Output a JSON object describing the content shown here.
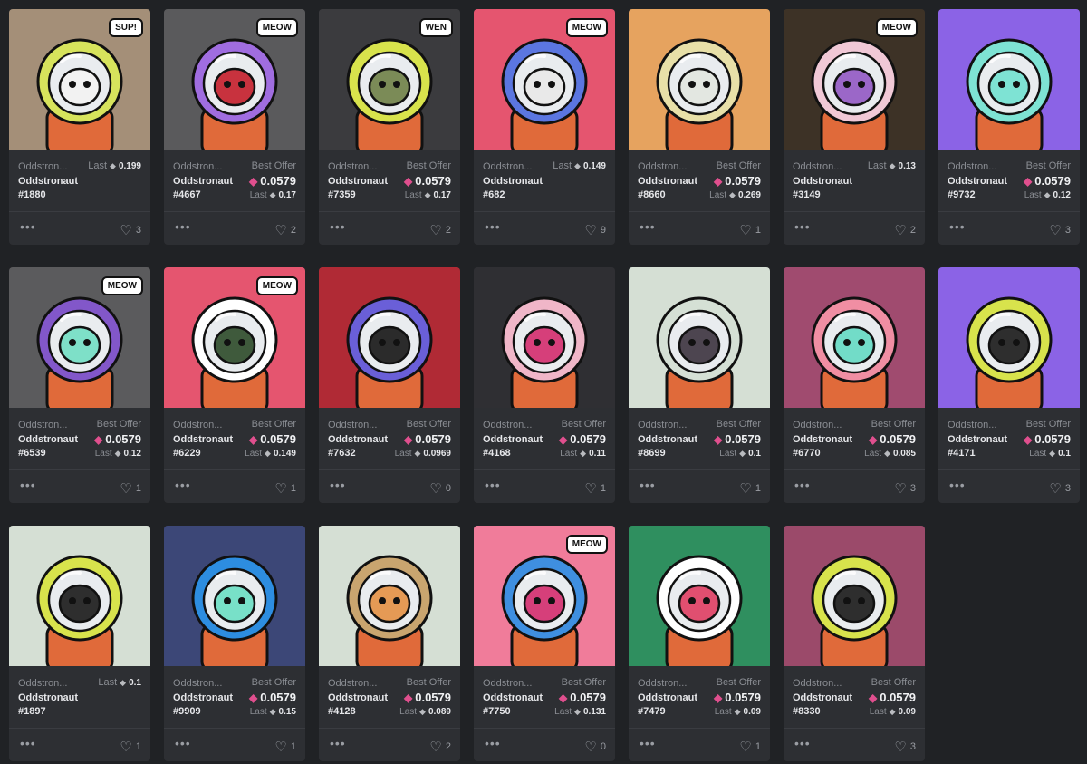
{
  "labels": {
    "best_offer": "Best Offer",
    "last": "Last"
  },
  "icons": {
    "more": "more-options-icon",
    "heart": "heart-icon",
    "eth": "ethereum-icon"
  },
  "colors": {
    "background": "#202225",
    "card": "#2d2f33",
    "accent_eth": "#e04f8e"
  },
  "cards": [
    {
      "collection": "Oddstron...",
      "name": "Oddstronaut",
      "number": "#1880",
      "has_offer": false,
      "offer": "",
      "last": "0.199",
      "likes": "3",
      "bg": "#a48f78",
      "speech": "SUP!",
      "helmet": "#d7e35c",
      "face": "#f2f2f2"
    },
    {
      "collection": "Oddstron...",
      "name": "Oddstronaut",
      "number": "#4667",
      "has_offer": true,
      "offer": "0.0579",
      "last": "0.17",
      "likes": "2",
      "bg": "#5a5a5c",
      "speech": "MEOW",
      "helmet": "#a06de0",
      "face": "#c8323e"
    },
    {
      "collection": "Oddstron...",
      "name": "Oddstronaut",
      "number": "#7359",
      "has_offer": true,
      "offer": "0.0579",
      "last": "0.17",
      "likes": "2",
      "bg": "#3b3b3e",
      "speech": "WEN",
      "helmet": "#d8e34c",
      "face": "#7b8b57"
    },
    {
      "collection": "Oddstron...",
      "name": "Oddstronaut",
      "number": "#682",
      "has_offer": false,
      "offer": "",
      "last": "0.149",
      "likes": "9",
      "bg": "#e5556f",
      "speech": "MEOW",
      "helmet": "#5b76e0",
      "face": "#e9e9e9"
    },
    {
      "collection": "Oddstron...",
      "name": "Oddstronaut",
      "number": "#8660",
      "has_offer": true,
      "offer": "0.0579",
      "last": "0.269",
      "likes": "1",
      "bg": "#e6a35f",
      "speech": "",
      "helmet": "#e8e0a8",
      "face": "#e3e7e1"
    },
    {
      "collection": "Oddstron...",
      "name": "Oddstronaut",
      "number": "#3149",
      "has_offer": false,
      "offer": "",
      "last": "0.13",
      "likes": "2",
      "bg": "#3d3226",
      "speech": "MEOW",
      "helmet": "#f0c8d6",
      "face": "#9b67c8"
    },
    {
      "collection": "Oddstron...",
      "name": "Oddstronaut",
      "number": "#9732",
      "has_offer": true,
      "offer": "0.0579",
      "last": "0.12",
      "likes": "3",
      "bg": "#8b63e6",
      "speech": "",
      "helmet": "#7ee3d4",
      "face": "#7ee3d4"
    },
    {
      "collection": "Oddstron...",
      "name": "Oddstronaut",
      "number": "#6539",
      "has_offer": true,
      "offer": "0.0579",
      "last": "0.12",
      "likes": "1",
      "bg": "#5b5b5d",
      "speech": "MEOW",
      "helmet": "#8257c9",
      "face": "#7ee0c8"
    },
    {
      "collection": "Oddstron...",
      "name": "Oddstronaut",
      "number": "#6229",
      "has_offer": true,
      "offer": "0.0579",
      "last": "0.149",
      "likes": "1",
      "bg": "#e5556f",
      "speech": "MEOW",
      "helmet": "#ffffff",
      "face": "#3f5a3c"
    },
    {
      "collection": "Oddstron...",
      "name": "Oddstronaut",
      "number": "#7632",
      "has_offer": true,
      "offer": "0.0579",
      "last": "0.0969",
      "likes": "0",
      "bg": "#b02a35",
      "speech": "",
      "helmet": "#6a5fd8",
      "face": "#2b2b2b"
    },
    {
      "collection": "Oddstron...",
      "name": "Oddstronaut",
      "number": "#4168",
      "has_offer": true,
      "offer": "0.0579",
      "last": "0.11",
      "likes": "1",
      "bg": "#2f2f33",
      "speech": "",
      "helmet": "#f0b6c8",
      "face": "#d63f7a"
    },
    {
      "collection": "Oddstron...",
      "name": "Oddstronaut",
      "number": "#8699",
      "has_offer": true,
      "offer": "0.0579",
      "last": "0.1",
      "likes": "1",
      "bg": "#d5dfd4",
      "speech": "",
      "helmet": "#d5e0d5",
      "face": "#4d4550"
    },
    {
      "collection": "Oddstron...",
      "name": "Oddstronaut",
      "number": "#6770",
      "has_offer": true,
      "offer": "0.0579",
      "last": "0.085",
      "likes": "3",
      "bg": "#a04b6f",
      "speech": "",
      "helmet": "#f08ea3",
      "face": "#72dcc8"
    },
    {
      "collection": "Oddstron...",
      "name": "Oddstronaut",
      "number": "#4171",
      "has_offer": true,
      "offer": "0.0579",
      "last": "0.1",
      "likes": "3",
      "bg": "#8b63e6",
      "speech": "",
      "helmet": "#d8e34c",
      "face": "#2e2e2e"
    },
    {
      "collection": "Oddstron...",
      "name": "Oddstronaut",
      "number": "#1897",
      "has_offer": false,
      "offer": "",
      "last": "0.1",
      "likes": "1",
      "bg": "#d5dfd4",
      "speech": "",
      "helmet": "#d8e34c",
      "face": "#2e2e2e"
    },
    {
      "collection": "Oddstron...",
      "name": "Oddstronaut",
      "number": "#9909",
      "has_offer": true,
      "offer": "0.0579",
      "last": "0.15",
      "likes": "1",
      "bg": "#3c4777",
      "speech": "",
      "helmet": "#2d8de0",
      "face": "#78e0c8"
    },
    {
      "collection": "Oddstron...",
      "name": "Oddstronaut",
      "number": "#4128",
      "has_offer": true,
      "offer": "0.0579",
      "last": "0.089",
      "likes": "2",
      "bg": "#d5dfd4",
      "speech": "",
      "helmet": "#c9a56f",
      "face": "#e59a55"
    },
    {
      "collection": "Oddstron...",
      "name": "Oddstronaut",
      "number": "#7750",
      "has_offer": true,
      "offer": "0.0579",
      "last": "0.131",
      "likes": "0",
      "bg": "#f07c9a",
      "speech": "MEOW",
      "helmet": "#3f8fe0",
      "face": "#d63f7a"
    },
    {
      "collection": "Oddstron...",
      "name": "Oddstronaut",
      "number": "#7479",
      "has_offer": true,
      "offer": "0.0579",
      "last": "0.09",
      "likes": "1",
      "bg": "#2f8f5f",
      "speech": "",
      "helmet": "#ffffff",
      "face": "#e04f70"
    },
    {
      "collection": "Oddstron...",
      "name": "Oddstronaut",
      "number": "#8330",
      "has_offer": true,
      "offer": "0.0579",
      "last": "0.09",
      "likes": "3",
      "bg": "#9b4a6a",
      "speech": "",
      "helmet": "#d8e34c",
      "face": "#2e2e2e"
    }
  ]
}
